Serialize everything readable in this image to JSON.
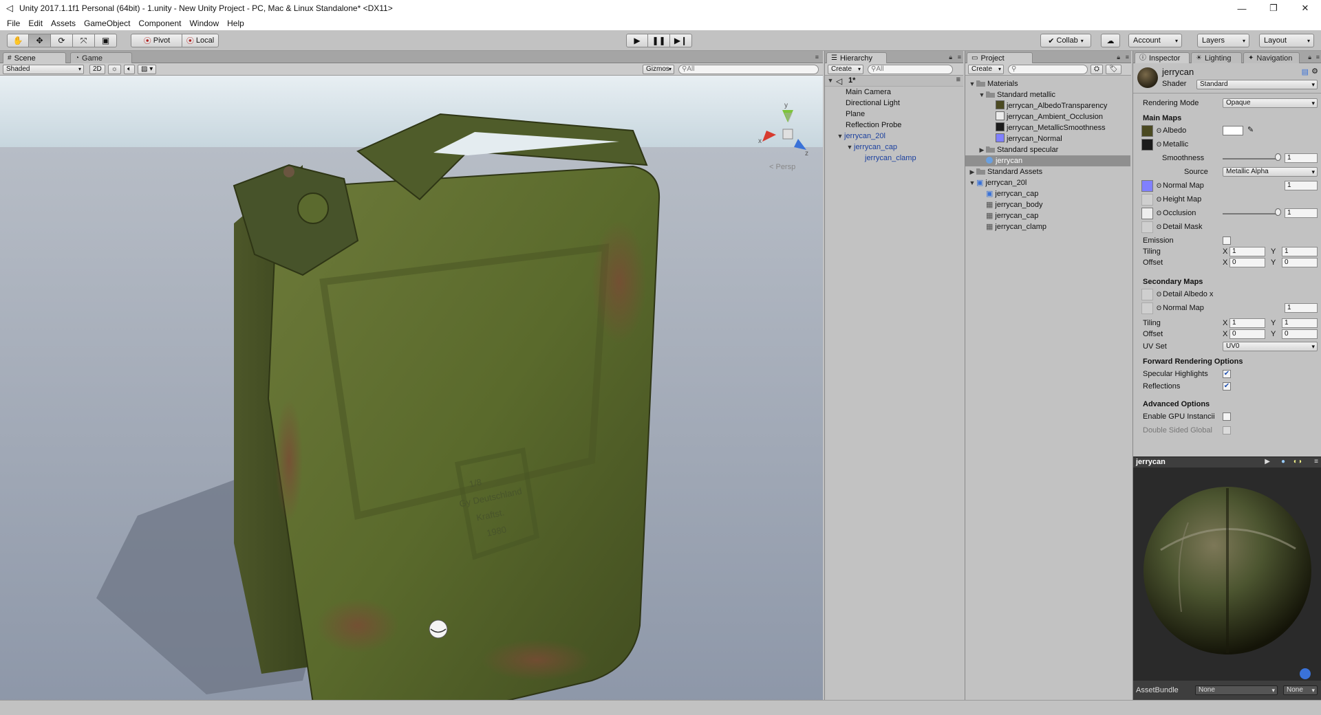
{
  "window": {
    "title": "Unity 2017.1.1f1 Personal (64bit) - 1.unity - New Unity Project - PC, Mac & Linux Standalone* <DX11>",
    "min_glyph": "—",
    "max_glyph": "❐",
    "close_glyph": "✕"
  },
  "menu": [
    "File",
    "Edit",
    "Assets",
    "GameObject",
    "Component",
    "Window",
    "Help"
  ],
  "toolbar": {
    "pivot": "Pivot",
    "local": "Local",
    "collab": "Collab",
    "account": "Account",
    "layers": "Layers",
    "layout": "Layout"
  },
  "scene_panel": {
    "tabs": [
      "Scene",
      "Game"
    ],
    "shading": "Shaded",
    "mode_2d": "2D",
    "gizmos": "Gizmos",
    "search_placeholder": "All",
    "persp_label": "< Persp",
    "gizmo_axes": {
      "x": "x",
      "y": "y",
      "z": "z"
    },
    "can_text": [
      "1/8",
      "Gy Deutschland",
      "Kraftst.",
      "1980"
    ]
  },
  "hierarchy": {
    "tab": "Hierarchy",
    "create": "Create",
    "search_placeholder": "All",
    "scene": "1*",
    "items": [
      "Main Camera",
      "Directional Light",
      "Plane",
      "Reflection Probe",
      "jerrycan_20l",
      "jerrycan_cap",
      "jerrycan_clamp"
    ]
  },
  "project": {
    "tab": "Project",
    "create": "Create",
    "items": [
      "Materials",
      "Standard metallic",
      "jerrycan_AlbedoTransparency",
      "jerrycan_Ambient_Occlusion",
      "jerrycan_MetallicSmoothness",
      "jerrycan_Normal",
      "Standard specular",
      "jerrycan",
      "Standard Assets",
      "jerrycan_20l",
      "jerrycan_cap",
      "jerrycan_body",
      "jerrycan_cap",
      "jerrycan_clamp"
    ]
  },
  "inspector": {
    "tabs": [
      "Inspector",
      "Lighting",
      "Navigation"
    ],
    "material_name": "jerrycan",
    "shader_label": "Shader",
    "shader_value": "Standard",
    "rendering_mode_label": "Rendering Mode",
    "rendering_mode_value": "Opaque",
    "main_maps": "Main Maps",
    "albedo": "Albedo",
    "metallic": "Metallic",
    "smoothness": "Smoothness",
    "smoothness_value": "1",
    "source": "Source",
    "source_value": "Metallic Alpha",
    "normal_map": "Normal Map",
    "normal_map_value": "1",
    "height_map": "Height Map",
    "occlusion": "Occlusion",
    "occlusion_value": "1",
    "detail_mask": "Detail Mask",
    "emission": "Emission",
    "tiling": "Tiling",
    "offset": "Offset",
    "x": "X",
    "y": "Y",
    "tiling_x": "1",
    "tiling_y": "1",
    "offset_x": "0",
    "offset_y": "0",
    "secondary_maps": "Secondary Maps",
    "detail_albedo": "Detail Albedo x",
    "sec_normal_map": "Normal Map",
    "sec_normal_value": "1",
    "sec_tiling_x": "1",
    "sec_tiling_y": "1",
    "sec_offset_x": "0",
    "sec_offset_y": "0",
    "uv_set": "UV Set",
    "uv_set_value": "UV0",
    "forward_rendering": "Forward Rendering Options",
    "specular_highlights": "Specular Highlights",
    "reflections": "Reflections",
    "advanced": "Advanced Options",
    "gpu_instancing": "Enable GPU Instancii",
    "double_sided": "Double Sided Global",
    "preview_title": "jerrycan",
    "assetbundle": "AssetBundle",
    "assetbundle_value": "None",
    "assetbundle_variant": "None"
  },
  "colors": {
    "accent_blue": "#1a3f9e",
    "normal_map": "#8080ff",
    "can_green": "#5e6a2c"
  }
}
